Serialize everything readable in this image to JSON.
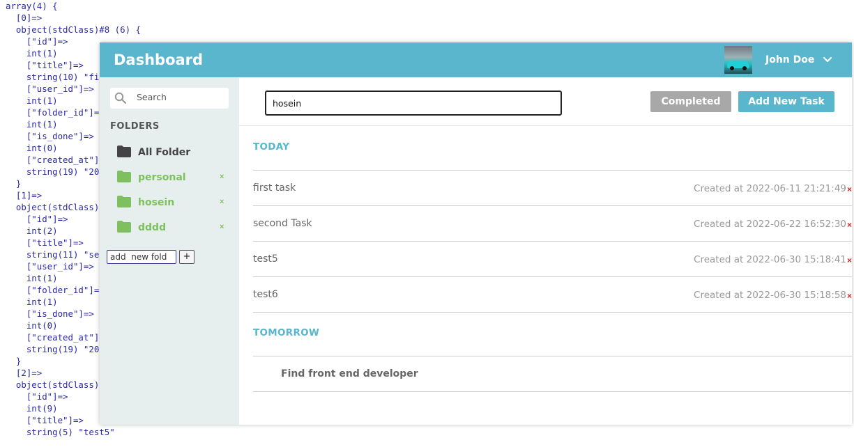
{
  "background_dump": [
    "array(4) {",
    "  [0]=>",
    "  object(stdClass)#8 (6) {",
    "    [\"id\"]=>",
    "    int(1)",
    "    [\"title\"]=>",
    "    string(10) \"fi",
    "    [\"user_id\"]=>",
    "    int(1)",
    "    [\"folder_id\"]=",
    "    int(1)",
    "    [\"is_done\"]=>",
    "    int(0)",
    "    [\"created_at\"]",
    "    string(19) \"20",
    "  }",
    "  [1]=>",
    "  object(stdClass)",
    "    [\"id\"]=>",
    "    int(2)",
    "    [\"title\"]=>",
    "    string(11) \"se",
    "    [\"user_id\"]=>",
    "    int(1)",
    "    [\"folder_id\"]=",
    "    int(1)",
    "    [\"is_done\"]=>",
    "    int(0)",
    "    [\"created_at\"]",
    "    string(19) \"20",
    "  }",
    "  [2]=>",
    "  object(stdClass)",
    "    [\"id\"]=>",
    "    int(9)",
    "    [\"title\"]=>",
    "    string(5) \"test5\""
  ],
  "header": {
    "title": "Dashboard",
    "user_name": "John Doe",
    "user_menu_icon": "chevron-down-icon",
    "color": "#59b6cd"
  },
  "sidebar": {
    "search_placeholder": "Search",
    "folders_heading": "FOLDERS",
    "folders": [
      {
        "label": "All Folder",
        "color": "#444444",
        "deletable": false
      },
      {
        "label": "personal",
        "color": "#7ec05f",
        "deletable": true
      },
      {
        "label": "hosein",
        "color": "#7ec05f",
        "deletable": true
      },
      {
        "label": "dddd",
        "color": "#7ec05f",
        "deletable": true
      }
    ],
    "delete_symbol": "×",
    "new_folder_value": "add  new fold",
    "new_folder_button": "+"
  },
  "main": {
    "task_input_value": "hosein",
    "completed_label": "Completed",
    "add_task_label": "Add New Task",
    "groups": [
      {
        "title": "TODAY",
        "tasks": [
          {
            "title": "first task",
            "date": "Created at 2022-06-11 21:21:49"
          },
          {
            "title": "second Task",
            "date": "Created at 2022-06-22 16:52:30"
          },
          {
            "title": "test5",
            "date": "Created at 2022-06-30 15:18:41"
          },
          {
            "title": "test6",
            "date": "Created at 2022-06-30 15:18:58"
          }
        ]
      },
      {
        "title": "TOMORROW",
        "tasks": [
          {
            "title": "Find front end developer"
          }
        ]
      }
    ],
    "delete_symbol": "×"
  }
}
